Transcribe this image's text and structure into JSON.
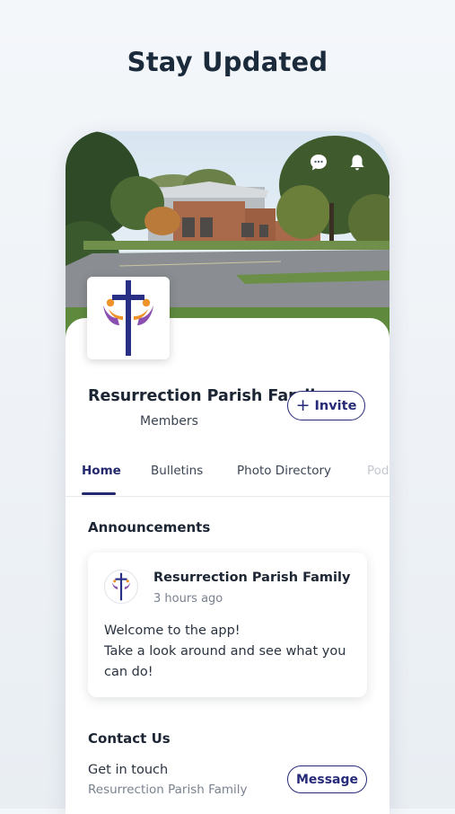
{
  "headline": "Stay Updated",
  "header_icons": {
    "chat": "chat-bubble-icon",
    "notifications": "bell-icon"
  },
  "group": {
    "name": "Resurrection Parish Family",
    "members_label": "Members",
    "invite_label": "Invite",
    "logo": "cross-logo"
  },
  "tabs": [
    {
      "label": "Home",
      "active": true
    },
    {
      "label": "Bulletins",
      "active": false
    },
    {
      "label": "Photo Directory",
      "active": false
    },
    {
      "label": "Pod",
      "active": false
    }
  ],
  "announcements": {
    "title": "Announcements",
    "post": {
      "author": "Resurrection Parish Family",
      "time": "3 hours ago",
      "lines": [
        "Welcome to the app!",
        "Take a look around and see what you",
        "can do!"
      ]
    }
  },
  "contact": {
    "title": "Contact Us",
    "line1": "Get in touch",
    "line2": "Resurrection Parish Family",
    "message_label": "Message"
  },
  "colors": {
    "accent": "#262a78",
    "logo_cross": "#2a2f86",
    "logo_orange": "#f0922a",
    "logo_purple": "#8a4fb0"
  }
}
